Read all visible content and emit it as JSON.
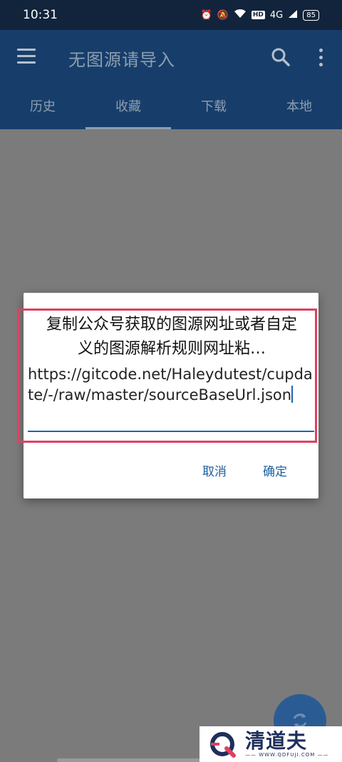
{
  "status_bar": {
    "time": "10:31",
    "network": "4G",
    "hd": "HD",
    "battery": "85"
  },
  "app_bar": {
    "title": "无图源请导入"
  },
  "tabs": [
    {
      "label": "历史",
      "active": false
    },
    {
      "label": "收藏",
      "active": true
    },
    {
      "label": "下载",
      "active": false
    },
    {
      "label": "本地",
      "active": false
    }
  ],
  "dialog": {
    "title": "复制公众号获取的图源网址或者自定义的图源解析规则网址粘…",
    "input_value": "https://gitcode.net/Haleydutest/cupdate/-/raw/master/sourceBaseUrl.json",
    "cancel_label": "取消",
    "ok_label": "确定"
  },
  "watermark": {
    "main": "清道夫",
    "sub": "—— WWW.QDFUJI.COM ——"
  },
  "colors": {
    "app_bar": "#173e6a",
    "status_bar": "#12243c",
    "accent": "#1b66b0",
    "highlight": "#e04060",
    "scrim": "#7b7b7b"
  }
}
